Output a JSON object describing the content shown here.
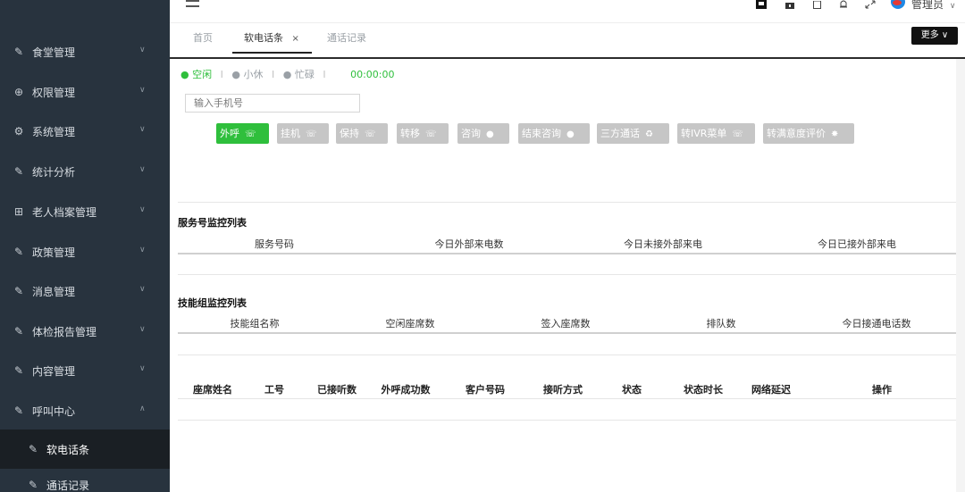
{
  "sidebar": {
    "items": [
      {
        "label": "食堂管理",
        "icon": "edit-square-icon"
      },
      {
        "label": "权限管理",
        "icon": "lock-icon"
      },
      {
        "label": "系统管理",
        "icon": "gear-icon"
      },
      {
        "label": "统计分析",
        "icon": "edit-square-icon"
      },
      {
        "label": "老人档案管理",
        "icon": "grid-icon"
      },
      {
        "label": "政策管理",
        "icon": "edit-square-icon"
      },
      {
        "label": "消息管理",
        "icon": "edit-square-icon"
      },
      {
        "label": "体检报告管理",
        "icon": "edit-square-icon"
      },
      {
        "label": "内容管理",
        "icon": "edit-square-icon"
      },
      {
        "label": "呼叫中心",
        "icon": "edit-square-icon"
      }
    ],
    "sub_items": [
      {
        "label": "软电话条",
        "active": true
      },
      {
        "label": "通话记录",
        "active": false
      }
    ]
  },
  "header": {
    "admin_label": "管理员"
  },
  "tabs": {
    "items": [
      {
        "label": "首页",
        "active": false
      },
      {
        "label": "软电话条",
        "active": true,
        "close": "×"
      },
      {
        "label": "通话记录",
        "active": false
      }
    ],
    "more_label": "更多 ∨"
  },
  "status": {
    "idle": "● 空闲",
    "rest": "● 小休",
    "busy": "● 忙碌",
    "sep": "I",
    "timer": "00:00:00"
  },
  "phone": {
    "placeholder": "输入手机号"
  },
  "actions": [
    {
      "label": "外呼",
      "icon": "☏",
      "color": "#2fbf3c"
    },
    {
      "label": "挂机",
      "icon": "☏",
      "color": "#c6c6c6"
    },
    {
      "label": "保持",
      "icon": "☏",
      "color": "#c6c6c6"
    },
    {
      "label": "转移",
      "icon": "☏",
      "color": "#c6c6c6"
    },
    {
      "label": "咨询",
      "icon": "●",
      "color": "#c6c6c6"
    },
    {
      "label": "结束咨询",
      "icon": "●",
      "color": "#c6c6c6"
    },
    {
      "label": "三方通话",
      "icon": "♻",
      "color": "#c6c6c6"
    },
    {
      "label": "转IVR菜单",
      "icon": "☏",
      "color": "#c6c6c6"
    },
    {
      "label": "转满意度评价",
      "icon": "✸",
      "color": "#c6c6c6"
    }
  ],
  "service_monitor": {
    "title": "服务号监控列表",
    "columns": [
      "服务号码",
      "今日外部来电数",
      "今日未接外部来电",
      "今日已接外部来电"
    ]
  },
  "skill_monitor": {
    "title": "技能组监控列表",
    "columns": [
      "技能组名称",
      "空闲座席数",
      "签入座席数",
      "排队数",
      "今日接通电话数"
    ]
  },
  "agent_table": {
    "columns": [
      "座席姓名",
      "工号",
      "已接听数",
      "外呼成功数",
      "客户号码",
      "接听方式",
      "状态",
      "状态时长",
      "网络延迟",
      "操作"
    ]
  }
}
